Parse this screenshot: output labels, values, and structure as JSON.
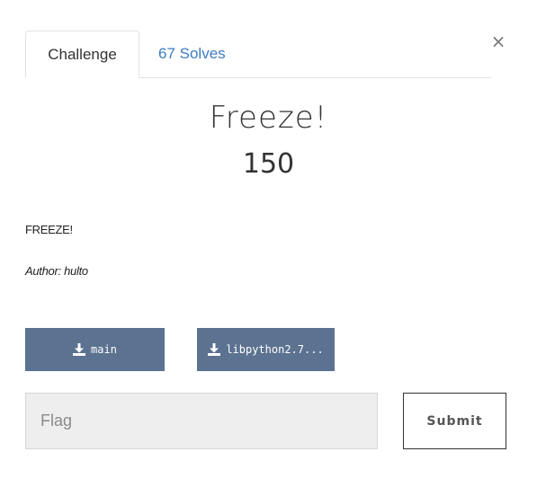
{
  "tabs": {
    "challenge_label": "Challenge",
    "solves_label": "67 Solves"
  },
  "close": {
    "symbol": "×"
  },
  "challenge": {
    "name": "Freeze!",
    "value": "150",
    "description": "FREEZE!",
    "author": "Author: hulto"
  },
  "files": [
    {
      "label": "main",
      "icon": "download-icon"
    },
    {
      "label": "libpython2.7...",
      "icon": "download-icon"
    }
  ],
  "flag": {
    "placeholder": "Flag",
    "value": ""
  },
  "submit": {
    "label": "Submit"
  },
  "colors": {
    "tab_link": "#3b7dc4",
    "file_button": "#5b7290",
    "input_background": "#eeeeee",
    "submit_border": "#333333"
  }
}
